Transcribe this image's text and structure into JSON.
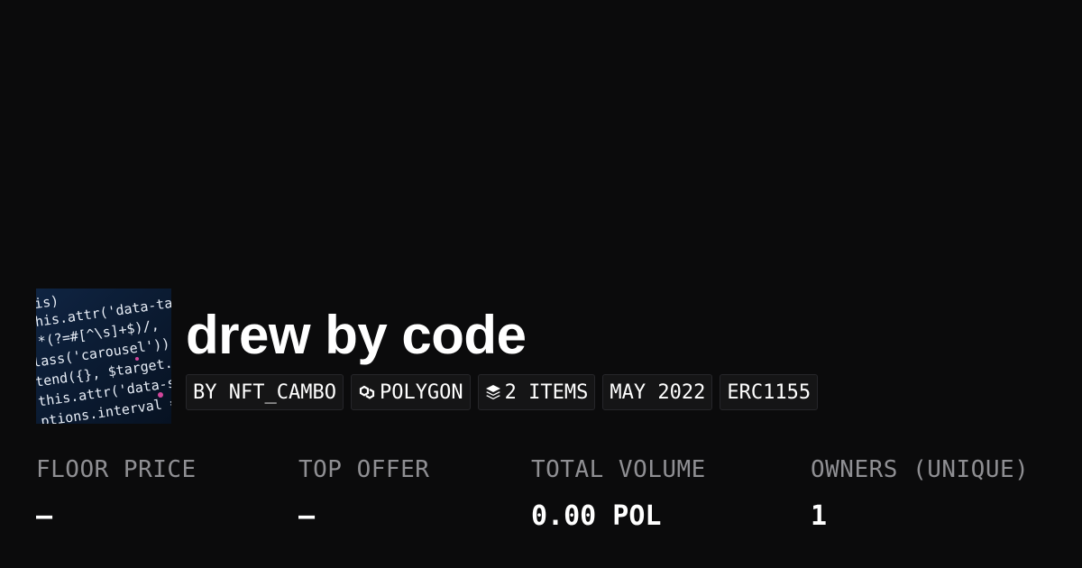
{
  "collection": {
    "title": "drew by code",
    "thumbnail_code_lines": [
      "his)",
      "this.attr('data-ta",
      ".*(?=#[^\\s]+$)/,",
      "lass('carousel'))",
      "tend({}, $target.",
      "this.attr('data-s",
      "ptions.interval ="
    ],
    "chips": [
      {
        "icon": "",
        "label": "BY NFT_CAMBO"
      },
      {
        "icon": "polygon-icon",
        "label": "POLYGON"
      },
      {
        "icon": "layers-icon",
        "label": "2 ITEMS"
      },
      {
        "icon": "",
        "label": "MAY 2022"
      },
      {
        "icon": "",
        "label": "ERC1155"
      }
    ]
  },
  "stats": [
    {
      "label": "FLOOR PRICE",
      "value": "–"
    },
    {
      "label": "TOP OFFER",
      "value": "–"
    },
    {
      "label": "TOTAL VOLUME",
      "value": "0.00 POL"
    },
    {
      "label": "OWNERS (UNIQUE)",
      "value": "1"
    }
  ],
  "colors": {
    "background": "#0b0b0c",
    "chip_background": "#151516",
    "label_gray": "#8f8f93"
  }
}
